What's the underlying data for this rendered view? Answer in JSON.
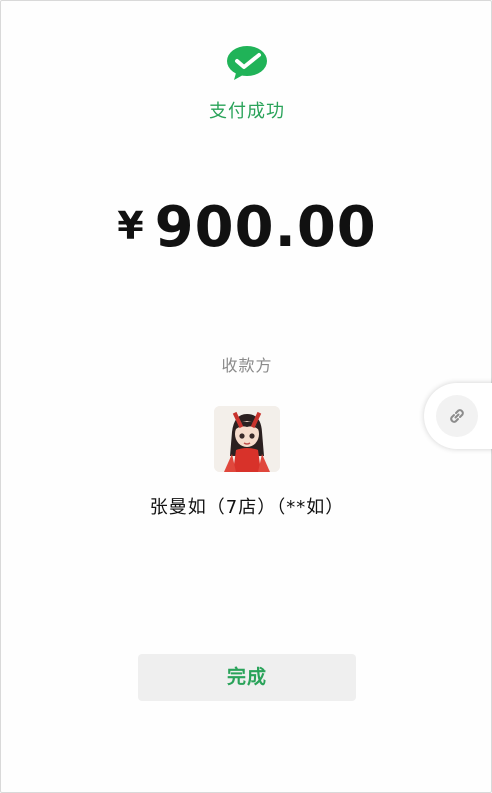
{
  "result": {
    "status_text": "支付成功",
    "currency_symbol": "¥",
    "amount": "900.00",
    "payee_label": "收款方",
    "payee_name": "张曼如（7店）（**如）"
  },
  "actions": {
    "done_label": "完成"
  },
  "icons": {
    "success": "wechat-pay-check-icon",
    "floating": "link-icon"
  },
  "colors": {
    "accent": "#2aa35a",
    "amount_text": "#111111",
    "muted_text": "#8a8a8a",
    "button_bg": "#efefef"
  }
}
